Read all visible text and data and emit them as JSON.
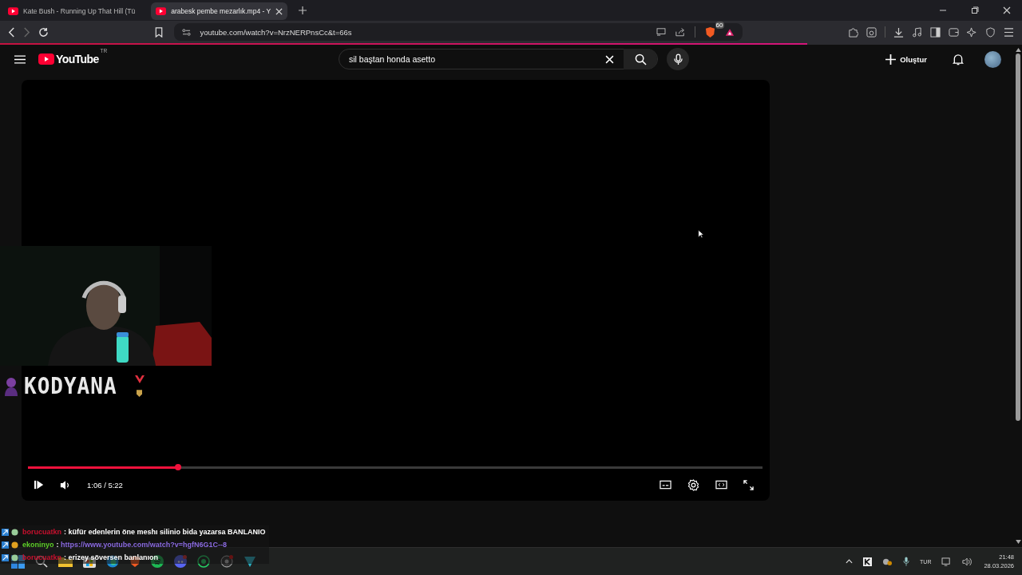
{
  "browser": {
    "tabs": [
      {
        "title": "Kate Bush - Running Up That Hill (Tü",
        "selected": false
      },
      {
        "title": "arabesk pembe mezarlık.mp4 - Y",
        "selected": true
      }
    ],
    "address": "youtube.com/watch?v=NrzNERPnsCc&t=66s",
    "shield_badge": "60",
    "load_progress": {
      "level": 0.79
    }
  },
  "youtube": {
    "logo": "YouTube",
    "region": "TR",
    "search": {
      "value": "sil baştan honda asetto"
    },
    "create_button": "Oluştur"
  },
  "player": {
    "progress": {
      "level": 0.204
    },
    "time": "1:06 / 5:22",
    "overlay": {
      "kind": "picture",
      "channel_logo": "KODYANA"
    }
  },
  "chat": [
    {
      "user": "borucuatkn",
      "color": "#c8102e",
      "message": ": küfür edenlerin öne meshı silinio bida yazarsa BANLANIO",
      "kind": "text"
    },
    {
      "user": "ekoninyo",
      "color": "#5fd02a",
      "message": ": ",
      "link": "https://www.youtube.com/watch?v=hgfN6G1C--8",
      "kind": "link"
    },
    {
      "user": "borucuatkn",
      "color": "#c8102e",
      "message": ": erizey söversen banlanıon",
      "kind": "text"
    }
  ],
  "taskbar": {
    "language": "TUR",
    "time": "21:48",
    "date": "28.03.2026"
  }
}
